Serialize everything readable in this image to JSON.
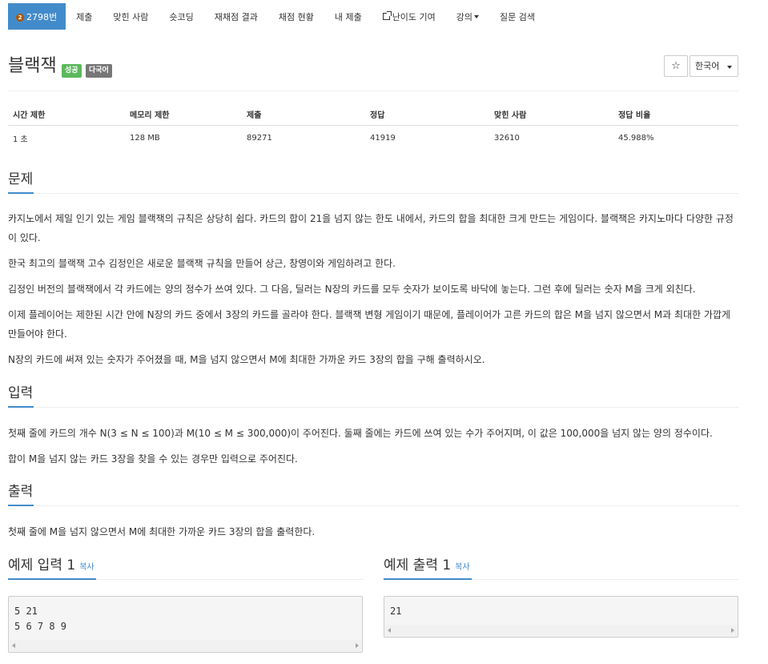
{
  "nav": {
    "problem_id": "2798번",
    "medal_text": "2",
    "items": [
      "제출",
      "맞힌 사람",
      "숏코딩",
      "재채점 결과",
      "채점 현황",
      "내 제출",
      "난이도 기여",
      "강의",
      "질문 검색"
    ]
  },
  "title": {
    "text": "블랙잭",
    "badge_success": "성공",
    "badge_multi": "다국어",
    "star": "☆",
    "language": "한국어"
  },
  "info": {
    "headers": [
      "시간 제한",
      "메모리 제한",
      "제출",
      "정답",
      "맞힌 사람",
      "정답 비율"
    ],
    "values": [
      "1 초",
      "128 MB",
      "89271",
      "41919",
      "32610",
      "45.988%"
    ]
  },
  "problem": {
    "heading": "문제",
    "paragraphs": [
      "카지노에서 제일 인기 있는 게임 블랙잭의 규칙은 상당히 쉽다. 카드의 합이 21을 넘지 않는 한도 내에서, 카드의 합을 최대한 크게 만드는 게임이다. 블랙잭은 카지노마다 다양한 규정이 있다.",
      "한국 최고의 블랙잭 고수 김정인은 새로운 블랙잭 규칙을 만들어 상근, 창영이와 게임하려고 한다.",
      "김정인 버전의 블랙잭에서 각 카드에는 양의 정수가 쓰여 있다. 그 다음, 딜러는 N장의 카드를 모두 숫자가 보이도록 바닥에 놓는다. 그런 후에 딜러는 숫자 M을 크게 외친다.",
      "이제 플레이어는 제한된 시간 안에 N장의 카드 중에서 3장의 카드를 골라야 한다. 블랙잭 변형 게임이기 때문에, 플레이어가 고른 카드의 합은 M을 넘지 않으면서 M과 최대한 가깝게 만들어야 한다.",
      "N장의 카드에 써져 있는 숫자가 주어졌을 때, M을 넘지 않으면서 M에 최대한 가까운 카드 3장의 합을 구해 출력하시오."
    ]
  },
  "input": {
    "heading": "입력",
    "paragraphs": [
      "첫째 줄에 카드의 개수 N(3 ≤ N ≤ 100)과 M(10 ≤ M ≤ 300,000)이 주어진다. 둘째 줄에는 카드에 쓰여 있는 수가 주어지며, 이 값은 100,000을 넘지 않는 양의 정수이다.",
      "합이 M을 넘지 않는 카드 3장을 찾을 수 있는 경우만 입력으로 주어진다."
    ]
  },
  "output": {
    "heading": "출력",
    "paragraphs": [
      "첫째 줄에 M을 넘지 않으면서 M에 최대한 가까운 카드 3장의 합을 출력한다."
    ]
  },
  "samples": {
    "input_heading": "예제 입력 1",
    "output_heading": "예제 출력 1",
    "copy": "복사",
    "input_text": "5 21\n5 6 7 8 9",
    "output_text": "21"
  }
}
